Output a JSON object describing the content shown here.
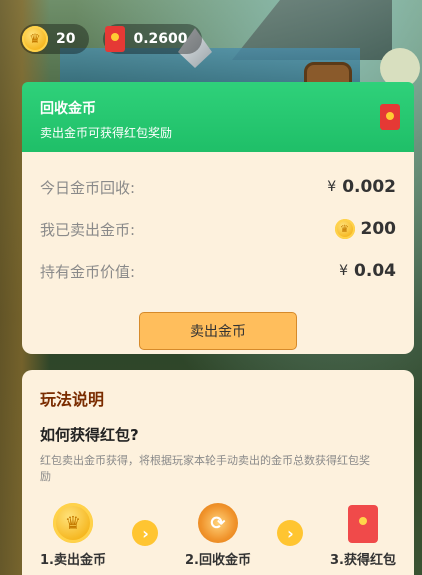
{
  "topbar": {
    "coins": "20",
    "balance": "0.2600"
  },
  "recycle": {
    "title": "回收金币",
    "subtitle": "卖出金币可获得红包奖励",
    "rows": [
      {
        "label": "今日金币回收:",
        "value": "0.002",
        "prefix": "¥"
      },
      {
        "label": "我已卖出金币:",
        "value": "200",
        "prefix": ""
      },
      {
        "label": "持有金币价值:",
        "value": "0.04",
        "prefix": "¥"
      }
    ],
    "sell_button": "卖出金币"
  },
  "rules": {
    "title": "玩法说明",
    "question": "如何获得红包?",
    "description": "红包卖出金币获得，将根据玩家本轮手动卖出的金币总数获得红包奖励",
    "steps": [
      {
        "label": "1.卖出金币",
        "icon": "coin-icon"
      },
      {
        "label": "2.回收金币",
        "icon": "recycle-icon"
      },
      {
        "label": "3.获得红包",
        "icon": "red-envelope-icon"
      }
    ]
  },
  "colors": {
    "green_header": "#1fbf68",
    "card_bg": "#fdf1dd",
    "button": "#ffbe5c",
    "rules_title": "#7a2c00"
  }
}
